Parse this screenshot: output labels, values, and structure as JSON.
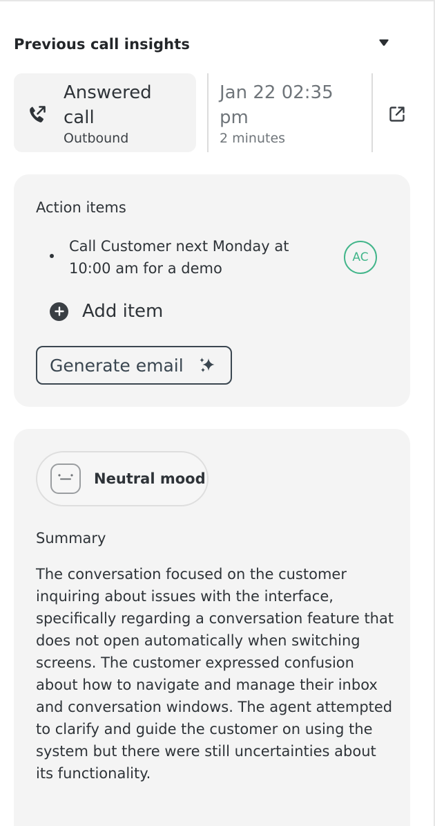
{
  "header": {
    "title": "Previous call insights"
  },
  "call": {
    "title": "Answered call",
    "direction": "Outbound",
    "datetime": "Jan 22 02:35 pm",
    "duration": "2 minutes"
  },
  "actions": {
    "label": "Action items",
    "items": [
      {
        "text": "Call Customer next Monday at 10:00 am for a demo",
        "assignee": "AC"
      }
    ],
    "add_label": "Add item",
    "generate_label": "Generate email"
  },
  "mood": {
    "label": "Neutral mood"
  },
  "summary": {
    "label": "Summary",
    "text": "The conversation focused on the customer inquiring about issues with the interface, specifically regarding a conversation feature that does not open automatically when switching screens. The customer expressed confusion about how to navigate and manage their inbox and conversation windows. The agent attempted to clarify and guide the customer on using the system but there were still uncertainties about its functionality."
  },
  "colors": {
    "accent": "#42b58a",
    "card_bg": "#f4f4f4",
    "text": "#2e3338",
    "muted": "#6f757a"
  },
  "icons": {
    "collapse": "caret-down-icon",
    "call": "outbound-call-icon",
    "open": "external-link-icon",
    "add": "plus-circle-icon",
    "ai": "sparkle-icon",
    "mood": "neutral-face-icon"
  }
}
